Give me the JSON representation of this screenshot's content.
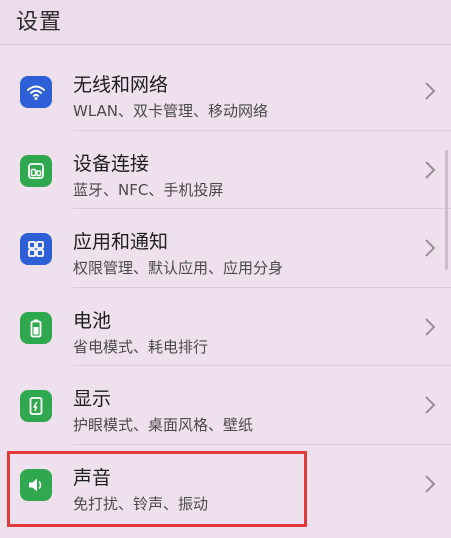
{
  "header": {
    "title": "设置"
  },
  "colors": {
    "blue": "#2f5fd6",
    "green": "#2fa84f",
    "highlight": "#e23a3a"
  },
  "items": [
    {
      "icon": "wifi-icon",
      "title": "无线和网络",
      "subtitle": "WLAN、双卡管理、移动网络"
    },
    {
      "icon": "device-connect-icon",
      "title": "设备连接",
      "subtitle": "蓝牙、NFC、手机投屏"
    },
    {
      "icon": "apps-grid-icon",
      "title": "应用和通知",
      "subtitle": "权限管理、默认应用、应用分身"
    },
    {
      "icon": "battery-icon",
      "title": "电池",
      "subtitle": "省电模式、耗电排行"
    },
    {
      "icon": "display-icon",
      "title": "显示",
      "subtitle": "护眼模式、桌面风格、壁纸"
    },
    {
      "icon": "sound-icon",
      "title": "声音",
      "subtitle": "免打扰、铃声、振动"
    }
  ]
}
